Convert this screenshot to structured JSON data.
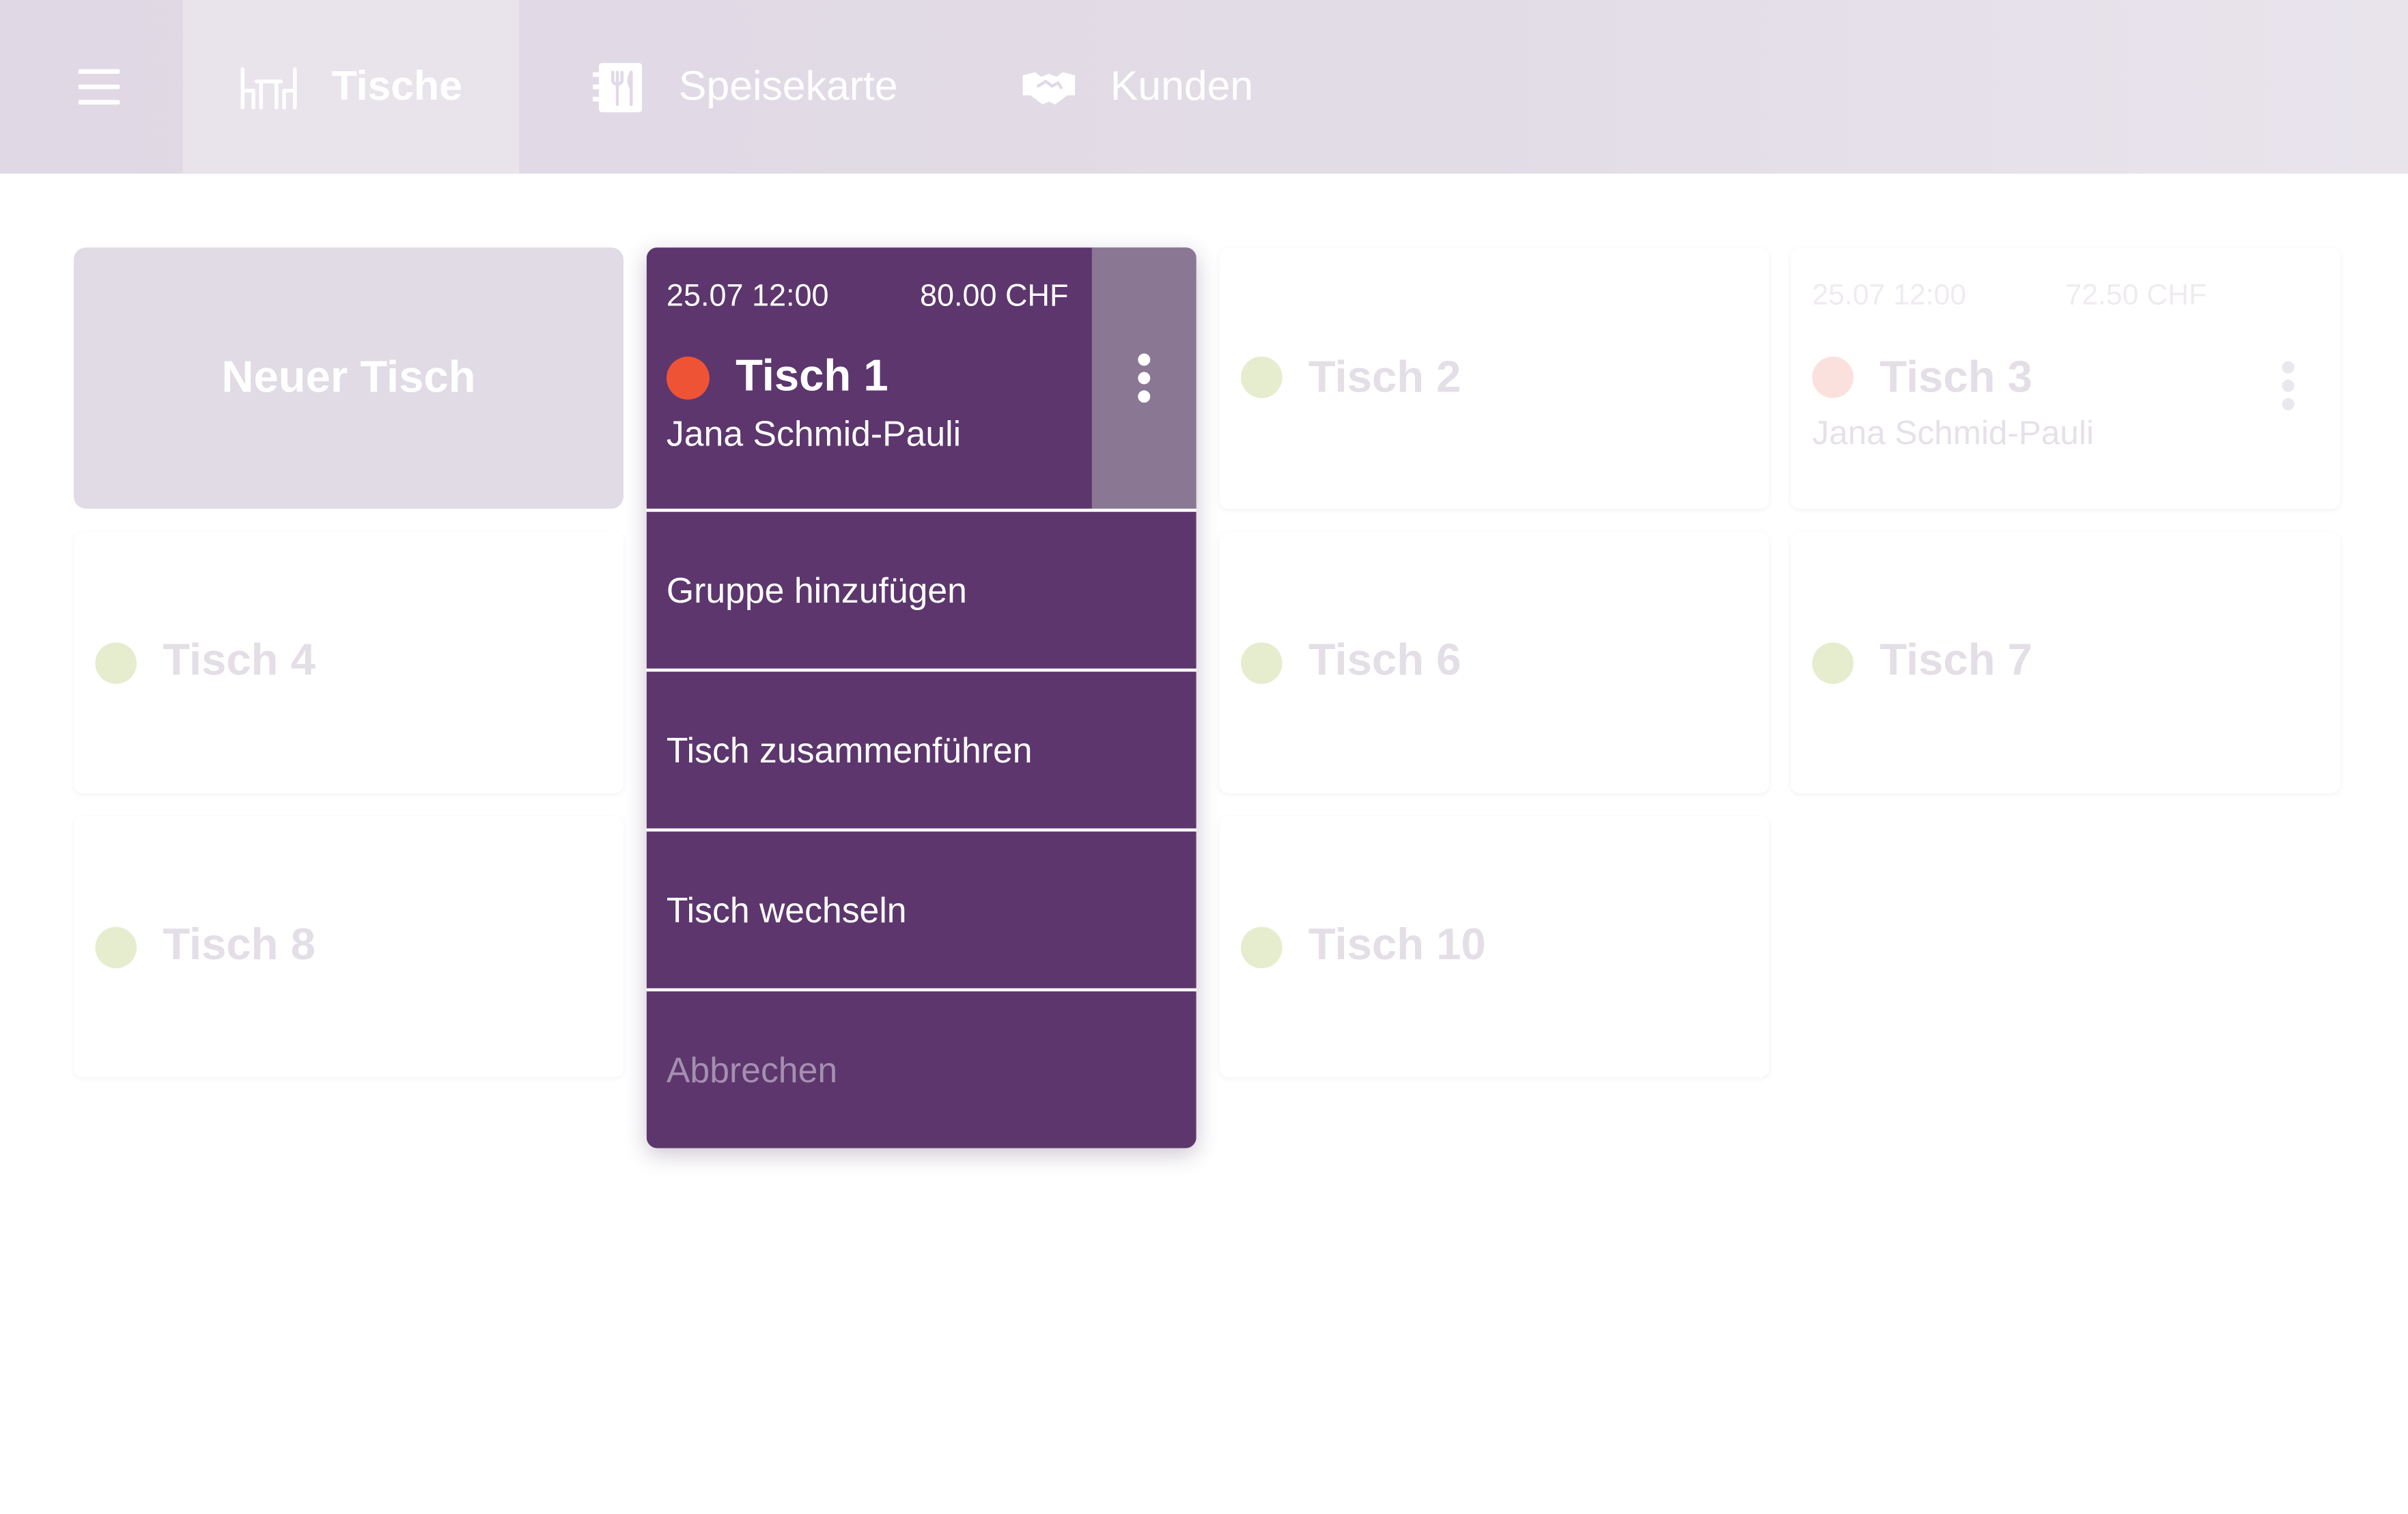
{
  "nav": {
    "menu_icon": "hamburger-menu-icon",
    "tabs": [
      {
        "label": "Tische",
        "icon": "table-chairs-icon",
        "active": true
      },
      {
        "label": "Speisekarte",
        "icon": "menu-card-fork-icon",
        "active": false
      },
      {
        "label": "Kunden",
        "icon": "handshake-icon",
        "active": false
      }
    ]
  },
  "colors": {
    "primary": "#5c366d",
    "status_free": "#e6edcf",
    "status_occupied": "#ef5336",
    "kebab_bg": "#8a7794"
  },
  "new_table": {
    "label": "Neuer Tisch"
  },
  "selected_table": {
    "date": "25.07 12:00",
    "amount": "80.00 CHF",
    "name": "Tisch 1",
    "guest": "Jana Schmid-Pauli",
    "status": "occupied"
  },
  "context_menu": {
    "items": [
      {
        "label": "Gruppe hinzufügen"
      },
      {
        "label": "Tisch zusammenführen"
      },
      {
        "label": "Tisch wechseln"
      }
    ],
    "cancel_label": "Abbrechen"
  },
  "tables": {
    "t2": {
      "name": "Tisch 2",
      "status": "free"
    },
    "t3": {
      "name": "Tisch 3",
      "date": "25.07 12:00",
      "amount": "72.50 CHF",
      "guest": "Jana Schmid-Pauli",
      "status": "occupied"
    },
    "t4": {
      "name": "Tisch 4",
      "status": "free"
    },
    "t6": {
      "name": "Tisch 6",
      "status": "free"
    },
    "t7": {
      "name": "Tisch 7",
      "status": "free"
    },
    "t8": {
      "name": "Tisch 8",
      "status": "free"
    },
    "t10": {
      "name": "Tisch 10",
      "status": "free"
    }
  }
}
